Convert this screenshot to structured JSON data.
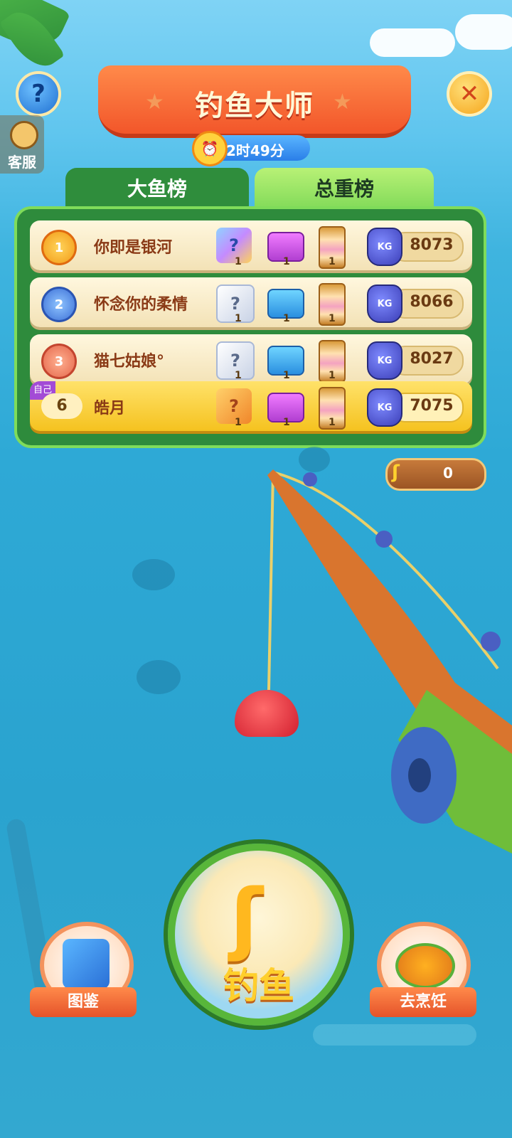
{
  "header": {
    "title": "钓鱼大师",
    "timer": "2时49分",
    "service_label": "客服"
  },
  "tabs": [
    {
      "label": "大鱼榜",
      "active": false
    },
    {
      "label": "总重榜",
      "active": true
    }
  ],
  "leaderboard": {
    "rows": [
      {
        "rank": "1",
        "name": "你即是银河",
        "rewards": [
          "1",
          "1",
          "1"
        ],
        "weight": "8073"
      },
      {
        "rank": "2",
        "name": "怀念你的柔情",
        "rewards": [
          "1",
          "1",
          "1"
        ],
        "weight": "8066"
      },
      {
        "rank": "3",
        "name": "猫七姑娘°",
        "rewards": [
          "1",
          "1",
          "1"
        ],
        "weight": "8027"
      }
    ],
    "me": {
      "tag": "自己",
      "rank": "6",
      "name": "皓月",
      "rewards": [
        "1",
        "1",
        "1"
      ],
      "weight": "7075"
    },
    "weight_unit": "KG"
  },
  "hook_counter": {
    "value": "0"
  },
  "buttons": {
    "fish": "钓鱼",
    "handbook": "图鉴",
    "cook": "去烹饪"
  },
  "colors": {
    "tab_active": "#7ed957",
    "panel": "#2e8b3c",
    "banner": "#f2562a",
    "accent": "#ffcf2c"
  }
}
